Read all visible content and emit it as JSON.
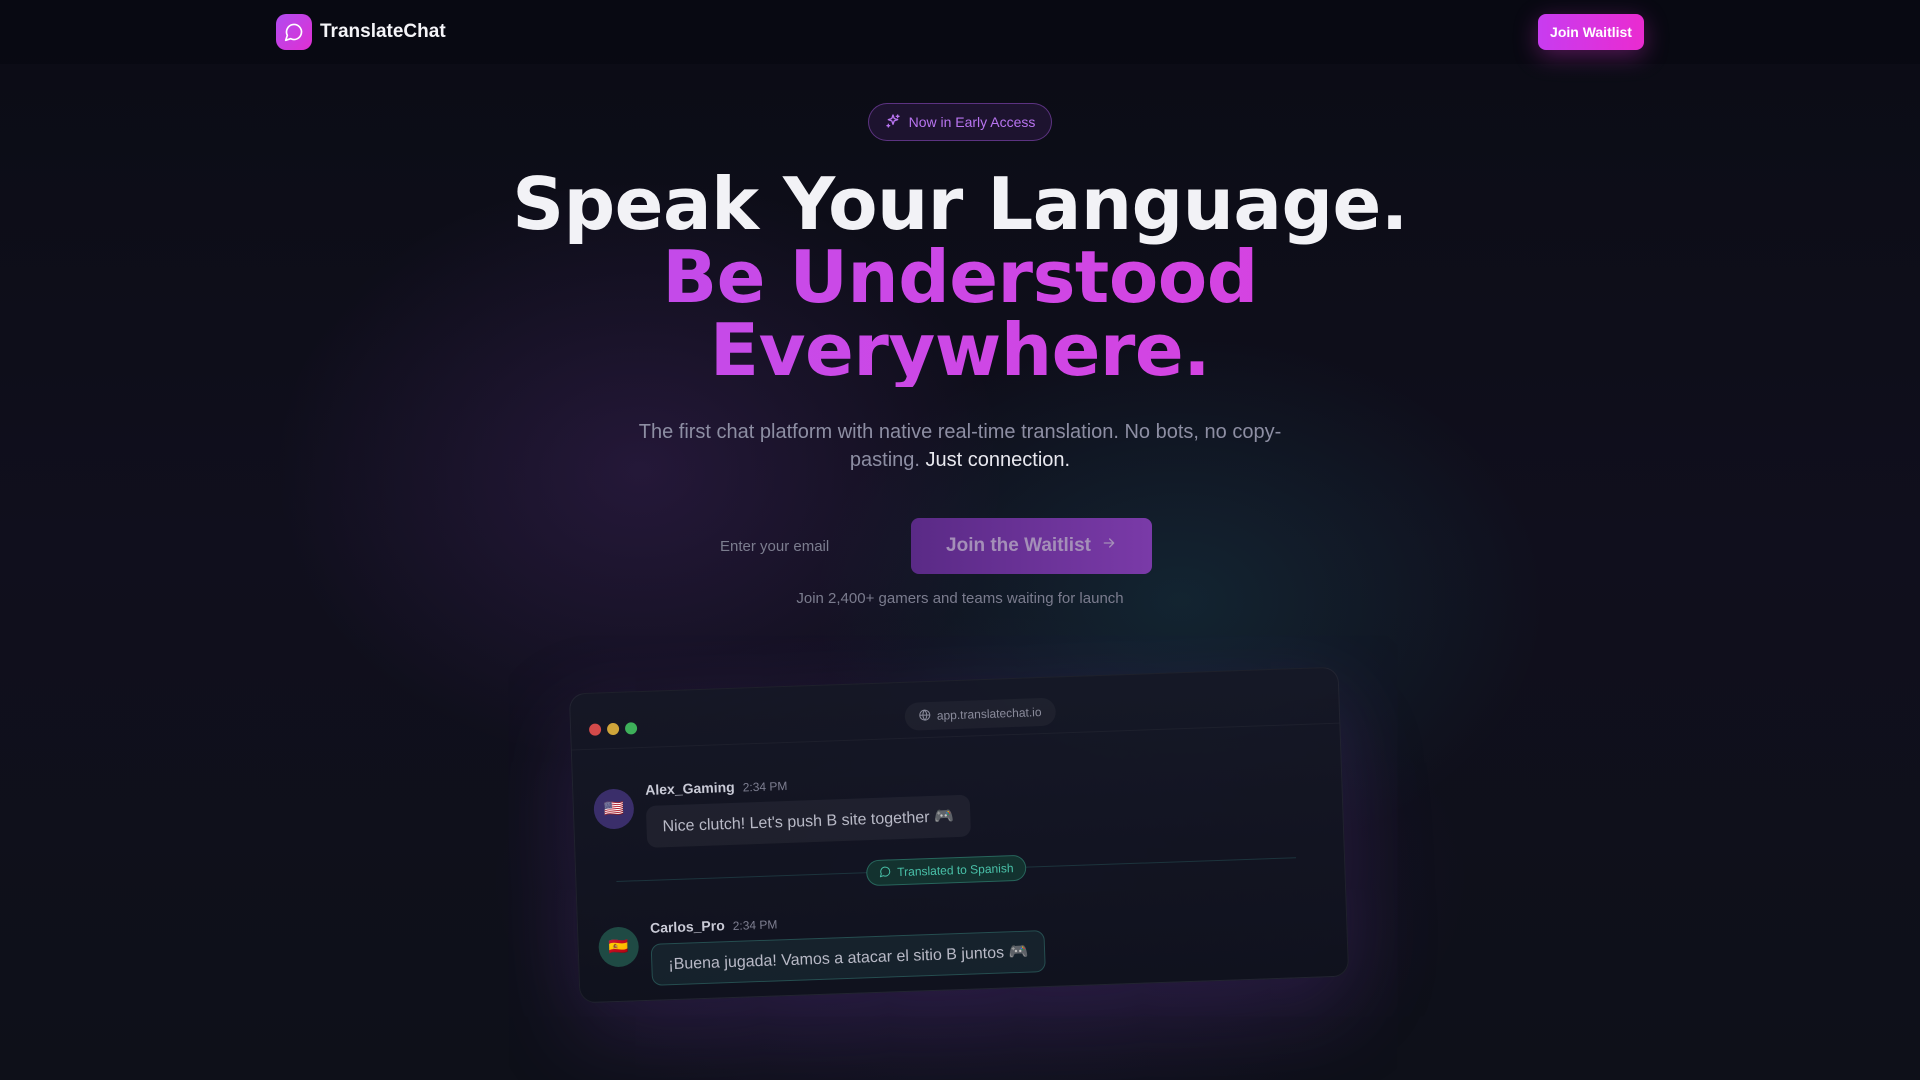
{
  "nav": {
    "brand": "TranslateChat",
    "cta_label": "Join Waitlist"
  },
  "hero": {
    "badge": "Now in Early Access",
    "headline_line1": "Speak Your Language.",
    "headline_line2": "Be Understood",
    "headline_line3": "Everywhere.",
    "subtitle": "The first chat platform with native real-time translation. No bots, no copy-pasting.",
    "subtitle_emphasis": "Just connection.",
    "email_placeholder": "Enter your email",
    "join_label": "Join the Waitlist",
    "waitlist_note": "Join 2,400+ gamers and teams waiting for launch"
  },
  "preview": {
    "url": "app.translatechat.io",
    "messages": [
      {
        "user": "Alex_Gaming",
        "time": "2:34 PM",
        "text": "Nice clutch! Let's push B site together 🎮",
        "flag": "🇺🇸"
      },
      {
        "user": "Carlos_Pro",
        "time": "2:34 PM",
        "text": "¡Buena jugada! Vamos a atacar el sitio B juntos 🎮",
        "flag": "🇪🇸"
      }
    ],
    "translated_label": "Translated to Spanish"
  },
  "colors": {
    "accent_start": "#b04cf0",
    "accent_end": "#e02fd2",
    "translate_accent": "#49c0a8",
    "background": "#0c0d17"
  },
  "icons": {
    "brand": "chat-bubble-icon",
    "badge": "sparkles-icon",
    "join": "arrow-right-icon",
    "url": "globe-icon",
    "translated": "chat-bubble-icon"
  }
}
